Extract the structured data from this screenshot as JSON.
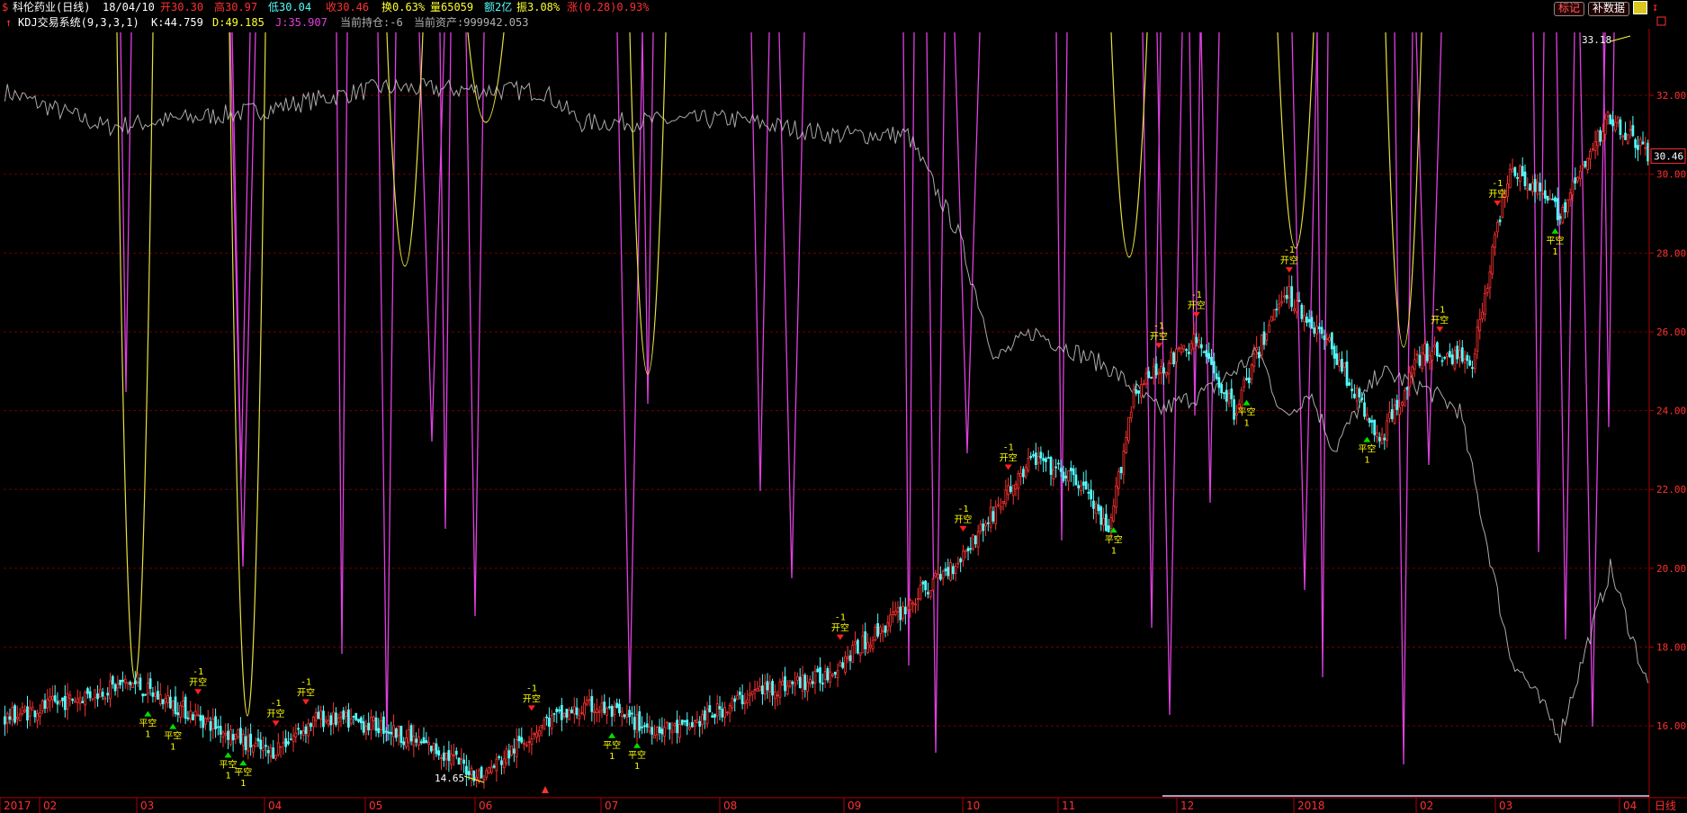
{
  "header": {
    "stock_name": "科伦药业(日线)",
    "date": "18/04/10",
    "open": "开30.30",
    "high": "高30.97",
    "low": "低30.04",
    "close": "收30.46",
    "turnover": "换0.63%",
    "volume": "量65059",
    "amount": "额2亿",
    "amplitude": "振3.08%",
    "change": "涨(0.28)0.93%",
    "btn_mark": "标记",
    "btn_fill": "补数据"
  },
  "indicator": {
    "name": "KDJ交易系统(9,3,3,1)",
    "k": "K:44.759",
    "d": "D:49.185",
    "j": "J:35.907",
    "position": "当前持仓:-6",
    "assets": "当前资产:999942.053"
  },
  "colors": {
    "up": "#ff3232",
    "down": "#54fcfc",
    "k_line": "#c8c8c8",
    "d_line": "#e8e040",
    "j_line": "#e040e0",
    "grid": "#6e0000",
    "axis": "#b00000",
    "buy": "#00e000",
    "sell": "#ff2020",
    "signal_text": "#ffff00"
  },
  "chart_data": {
    "type": "candlestick",
    "ylim": [
      14.2,
      33.6
    ],
    "y_ticks": [
      "32.00",
      "30.00",
      "28.00",
      "26.00",
      "24.00",
      "22.00",
      "20.00",
      "18.00",
      "16.00"
    ],
    "last_price": "30.46",
    "max_label": "33.18",
    "min_label": "14.65",
    "x_months": [
      "2017",
      "02",
      "03",
      "04",
      "05",
      "06",
      "07",
      "08",
      "09",
      "10",
      "11",
      "12",
      "2018",
      "02",
      "03",
      "04"
    ],
    "period_label": "日线",
    "anchors": [
      [
        0,
        16.2
      ],
      [
        50,
        17.1
      ],
      [
        75,
        16.3
      ],
      [
        105,
        15.3
      ],
      [
        125,
        16.2
      ],
      [
        150,
        16.0
      ],
      [
        175,
        15.3
      ],
      [
        190,
        14.7
      ],
      [
        215,
        16.1
      ],
      [
        235,
        16.5
      ],
      [
        255,
        16.0
      ],
      [
        270,
        15.9
      ],
      [
        300,
        16.9
      ],
      [
        325,
        17.2
      ],
      [
        350,
        18.5
      ],
      [
        380,
        20.2
      ],
      [
        410,
        22.8
      ],
      [
        430,
        22.1
      ],
      [
        440,
        20.8
      ],
      [
        450,
        24.5
      ],
      [
        475,
        25.8
      ],
      [
        490,
        24.0
      ],
      [
        510,
        27.1
      ],
      [
        530,
        25.5
      ],
      [
        548,
        23.2
      ],
      [
        565,
        25.5
      ],
      [
        585,
        25.3
      ],
      [
        600,
        30.3
      ],
      [
        620,
        29.0
      ],
      [
        640,
        31.5
      ],
      [
        655,
        30.5
      ]
    ],
    "k_anchors": [
      [
        0,
        32.1
      ],
      [
        40,
        31.2
      ],
      [
        100,
        31.6
      ],
      [
        150,
        32.2
      ],
      [
        215,
        32.1
      ],
      [
        230,
        31.3
      ],
      [
        290,
        31.4
      ],
      [
        330,
        31.0
      ],
      [
        360,
        31.0
      ],
      [
        380,
        28.5
      ],
      [
        395,
        25.3
      ],
      [
        410,
        26.0
      ],
      [
        440,
        25.1
      ],
      [
        460,
        24.0
      ],
      [
        480,
        24.5
      ],
      [
        500,
        25.5
      ],
      [
        510,
        23.8
      ],
      [
        520,
        24.5
      ],
      [
        530,
        23.0
      ],
      [
        548,
        25.0
      ],
      [
        565,
        24.6
      ],
      [
        580,
        24.0
      ],
      [
        600,
        17.8
      ],
      [
        620,
        15.8
      ],
      [
        640,
        20.0
      ],
      [
        655,
        17.0
      ]
    ],
    "signals": [
      {
        "i": 57,
        "t": "buy",
        "label": "平空",
        "qty": "1"
      },
      {
        "i": 67,
        "t": "buy",
        "label": "平空",
        "qty": "1"
      },
      {
        "i": 77,
        "t": "sell",
        "label": "开空",
        "qty": "-1"
      },
      {
        "i": 89,
        "t": "buy",
        "label": "平空",
        "qty": "1"
      },
      {
        "i": 95,
        "t": "buy",
        "label": "平空",
        "qty": "1"
      },
      {
        "i": 108,
        "t": "sell",
        "label": "开空",
        "qty": "-1"
      },
      {
        "i": 120,
        "t": "sell",
        "label": "开空",
        "qty": "-1"
      },
      {
        "i": 210,
        "t": "sell",
        "label": "开空",
        "qty": "-1"
      },
      {
        "i": 242,
        "t": "buy",
        "label": "平空",
        "qty": "1"
      },
      {
        "i": 252,
        "t": "buy",
        "label": "平空",
        "qty": "1"
      },
      {
        "i": 333,
        "t": "sell",
        "label": "开空",
        "qty": "-1"
      },
      {
        "i": 382,
        "t": "sell",
        "label": "开空",
        "qty": "-1"
      },
      {
        "i": 400,
        "t": "sell",
        "label": "开空",
        "qty": "-1"
      },
      {
        "i": 442,
        "t": "buy",
        "label": "平空",
        "qty": "1"
      },
      {
        "i": 460,
        "t": "sell",
        "label": "开空",
        "qty": "-1"
      },
      {
        "i": 475,
        "t": "sell",
        "label": "开空",
        "qty": "-1"
      },
      {
        "i": 495,
        "t": "buy",
        "label": "平空",
        "qty": "1"
      },
      {
        "i": 512,
        "t": "sell",
        "label": "开空",
        "qty": "-1"
      },
      {
        "i": 543,
        "t": "buy",
        "label": "平空",
        "qty": "1"
      },
      {
        "i": 572,
        "t": "sell",
        "label": "开空",
        "qty": "-1"
      },
      {
        "i": 595,
        "t": "sell",
        "label": "开空",
        "qty": "-1"
      },
      {
        "i": 618,
        "t": "buy",
        "label": "平空",
        "qty": "1"
      }
    ]
  }
}
